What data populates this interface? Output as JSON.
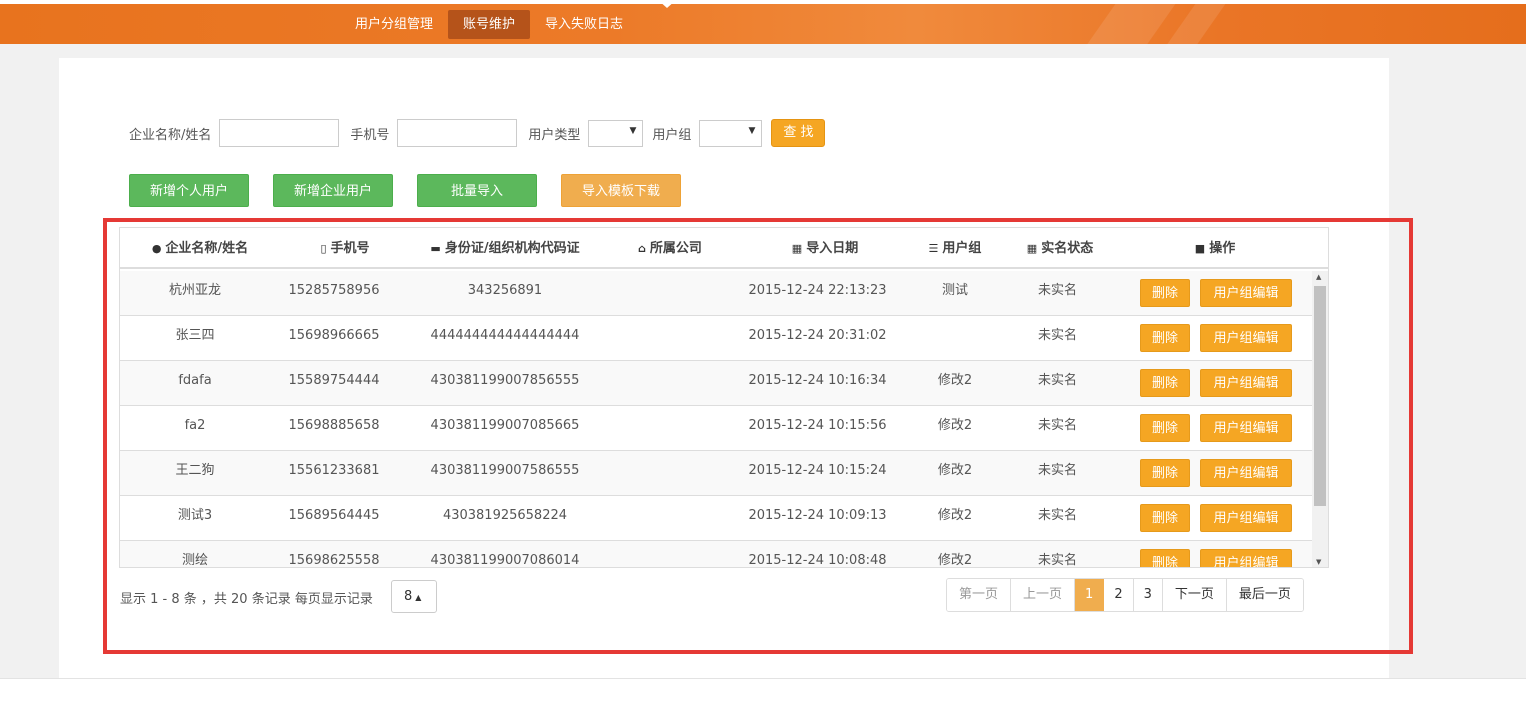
{
  "nav": {
    "items": [
      {
        "label": "用户分组管理",
        "active": false
      },
      {
        "label": "账号维护",
        "active": true
      },
      {
        "label": "导入失败日志",
        "active": false
      }
    ]
  },
  "search": {
    "company_label": "企业名称/姓名",
    "company_value": "",
    "phone_label": "手机号",
    "phone_value": "",
    "user_type_label": "用户类型",
    "user_type_value": "",
    "user_group_label": "用户组",
    "user_group_value": "",
    "find_label": "查 找"
  },
  "actions": {
    "add_personal": "新增个人用户",
    "add_company": "新增企业用户",
    "batch_import": "批量导入",
    "download_template": "导入模板下载"
  },
  "table": {
    "columns": [
      {
        "label": "企业名称/姓名",
        "icon": "user-icon"
      },
      {
        "label": "手机号",
        "icon": "phone-icon"
      },
      {
        "label": "身份证/组织机构代码证",
        "icon": "id-card-icon"
      },
      {
        "label": "所属公司",
        "icon": "home-icon"
      },
      {
        "label": "导入日期",
        "icon": "calendar-icon"
      },
      {
        "label": "用户组",
        "icon": "list-icon"
      },
      {
        "label": "实名状态",
        "icon": "grid-icon"
      },
      {
        "label": "操作",
        "icon": "briefcase-icon"
      }
    ],
    "rows": [
      {
        "name": "杭州亚龙",
        "phone": "15285758956",
        "id": "343256891",
        "company": "",
        "date": "2015-12-24 22:13:23",
        "group": "测试",
        "status": "未实名"
      },
      {
        "name": "张三四",
        "phone": "15698966665",
        "id": "444444444444444444",
        "company": "",
        "date": "2015-12-24 20:31:02",
        "group": "",
        "status": "未实名"
      },
      {
        "name": "fdafa",
        "phone": "15589754444",
        "id": "430381199007856555",
        "company": "",
        "date": "2015-12-24 10:16:34",
        "group": "修改2",
        "status": "未实名"
      },
      {
        "name": "fa2",
        "phone": "15698885658",
        "id": "430381199007085665",
        "company": "",
        "date": "2015-12-24 10:15:56",
        "group": "修改2",
        "status": "未实名"
      },
      {
        "name": "王二狗",
        "phone": "15561233681",
        "id": "430381199007586555",
        "company": "",
        "date": "2015-12-24 10:15:24",
        "group": "修改2",
        "status": "未实名"
      },
      {
        "name": "测试3",
        "phone": "15689564445",
        "id": "430381925658224",
        "company": "",
        "date": "2015-12-24 10:09:13",
        "group": "修改2",
        "status": "未实名"
      },
      {
        "name": "测绘",
        "phone": "15698625558",
        "id": "430381199007086014",
        "company": "",
        "date": "2015-12-24 10:08:48",
        "group": "修改2",
        "status": "未实名"
      }
    ],
    "delete_label": "删除",
    "edit_group_label": "用户组编辑"
  },
  "pager": {
    "info": "显示 1 - 8 条 ，共 20 条记录 每页显示记录",
    "per_page": "8",
    "first": "第一页",
    "prev": "上一页",
    "pages": [
      "1",
      "2",
      "3"
    ],
    "current": "1",
    "next": "下一页",
    "last": "最后一页"
  },
  "colors": {
    "brand_orange": "#e8731e",
    "button_green": "#5cb85c",
    "button_orange": "#f5a623",
    "highlight_red": "#e53935"
  }
}
